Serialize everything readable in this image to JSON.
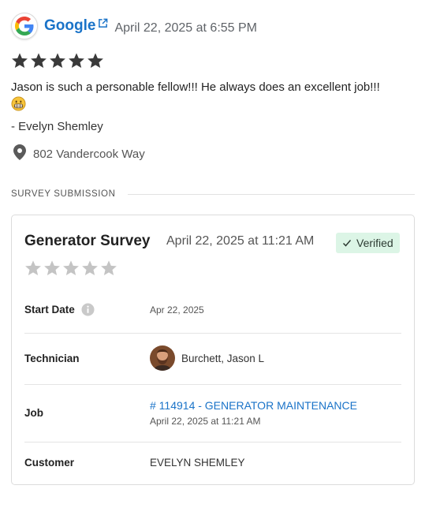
{
  "review": {
    "source": "Google",
    "date": "April 22, 2025 at 6:55 PM",
    "rating": 5,
    "text": "Jason is such a personable fellow!!! He always does an excellent job!!!",
    "author": "- Evelyn Shemley",
    "location": "802 Vandercook Way"
  },
  "survey_section": {
    "title": "SURVEY SUBMISSION"
  },
  "survey": {
    "title": "Generator Survey",
    "date": "April 22, 2025 at 11:21 AM",
    "verified_label": "Verified",
    "rating": 0,
    "fields": {
      "start_date_label": "Start Date",
      "start_date_value": "Apr 22, 2025",
      "technician_label": "Technician",
      "technician_value": "Burchett, Jason L",
      "job_label": "Job",
      "job_link": "# 114914 - GENERATOR MAINTENANCE",
      "job_date": "April 22, 2025 at 11:21 AM",
      "customer_label": "Customer",
      "customer_value": "EVELYN SHEMLEY"
    }
  },
  "colors": {
    "link": "#1a73c8",
    "star_filled": "#3a3a3a",
    "star_empty": "#c4c4c4",
    "verified_bg": "#dcf5e6"
  },
  "icons": [
    "google-logo-icon",
    "external-link-icon",
    "star-icon",
    "grinning-emoji-icon",
    "map-pin-icon",
    "check-icon",
    "info-icon"
  ]
}
